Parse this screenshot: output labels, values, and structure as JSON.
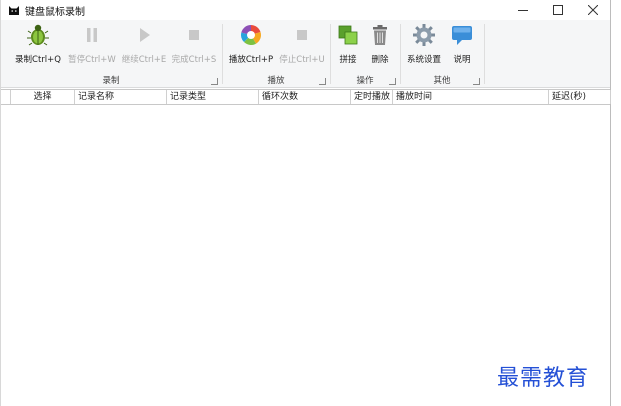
{
  "window": {
    "title": "键盘鼠标录制"
  },
  "ribbon": {
    "groups": [
      {
        "label": "录制",
        "buttons": [
          {
            "label": "录制Ctrl+Q",
            "icon": "record-bug-icon",
            "enabled": true
          },
          {
            "label": "暂停Ctrl+W",
            "icon": "pause-icon",
            "enabled": false
          },
          {
            "label": "继续Ctrl+E",
            "icon": "play-icon",
            "enabled": false
          },
          {
            "label": "完成Ctrl+S",
            "icon": "stop-icon",
            "enabled": false
          }
        ]
      },
      {
        "label": "播放",
        "buttons": [
          {
            "label": "播放Ctrl+P",
            "icon": "color-wheel-play-icon",
            "enabled": true
          },
          {
            "label": "停止Ctrl+U",
            "icon": "stop-icon",
            "enabled": false
          }
        ]
      },
      {
        "label": "操作",
        "buttons": [
          {
            "label": "拼接",
            "icon": "merge-icon",
            "enabled": true
          },
          {
            "label": "删除",
            "icon": "trash-icon",
            "enabled": true
          }
        ]
      },
      {
        "label": "其他",
        "buttons": [
          {
            "label": "系统设置",
            "icon": "gear-icon",
            "enabled": true
          },
          {
            "label": "说明",
            "icon": "speech-bubble-icon",
            "enabled": true
          }
        ]
      }
    ]
  },
  "table": {
    "columns": [
      "选择",
      "记录名称",
      "记录类型",
      "循环次数",
      "定时播放",
      "播放时间",
      "延迟(秒)"
    ],
    "rows": []
  },
  "watermark": "最需教育"
}
